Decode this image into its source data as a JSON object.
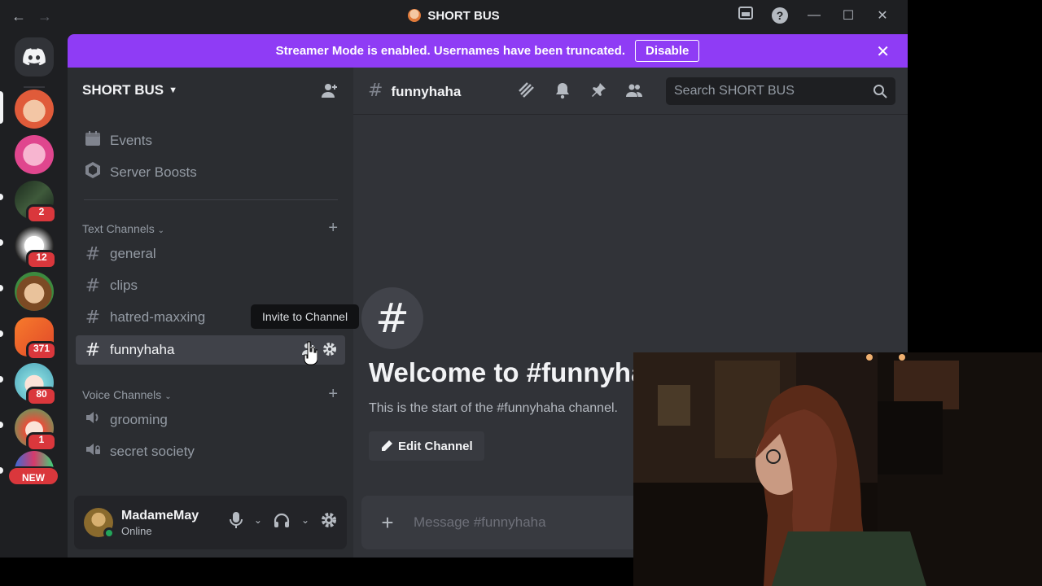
{
  "window": {
    "title": "SHORT BUS",
    "nav_back": "←",
    "nav_forward": "→",
    "help_label": "?",
    "minimize": "—",
    "maximize": "☐",
    "close": "✕"
  },
  "guild_rail": {
    "servers": [
      {
        "name": "server-red-hair",
        "badge": ""
      },
      {
        "name": "server-pink-cloud",
        "badge": ""
      },
      {
        "name": "server-forest",
        "badge": "2"
      },
      {
        "name": "server-horse",
        "badge": "12"
      },
      {
        "name": "server-boy",
        "badge": ""
      },
      {
        "name": "server-orange",
        "badge": "371"
      },
      {
        "name": "server-anime-blue",
        "badge": "80"
      },
      {
        "name": "server-anime-red",
        "badge": "1"
      }
    ],
    "new_label": "NEW"
  },
  "banner": {
    "message": "Streamer Mode is enabled. Usernames have been truncated.",
    "button": "Disable",
    "close": "✕"
  },
  "sidebar": {
    "server_name": "SHORT BUS",
    "events": "Events",
    "boosts": "Server Boosts",
    "text_category": "Text Channels",
    "voice_category": "Voice Channels",
    "text_channels": [
      "general",
      "clips",
      "hatred-maxxing",
      "funnyhaha"
    ],
    "voice_channels": [
      "grooming",
      "secret society"
    ],
    "tooltip": "Invite to Channel"
  },
  "user": {
    "name": "MadameMay",
    "status": "Online"
  },
  "channel": {
    "name": "funnyhaha",
    "search_placeholder": "Search SHORT BUS",
    "welcome_title": "Welcome to #funnyhaha!",
    "welcome_sub": "This is the start of the #funnyhaha channel.",
    "edit_button": "Edit Channel",
    "message_placeholder": "Message #funnyhaha"
  },
  "colors": {
    "accent": "#8f3cf5",
    "badge": "#da373c",
    "online": "#23a55a"
  }
}
